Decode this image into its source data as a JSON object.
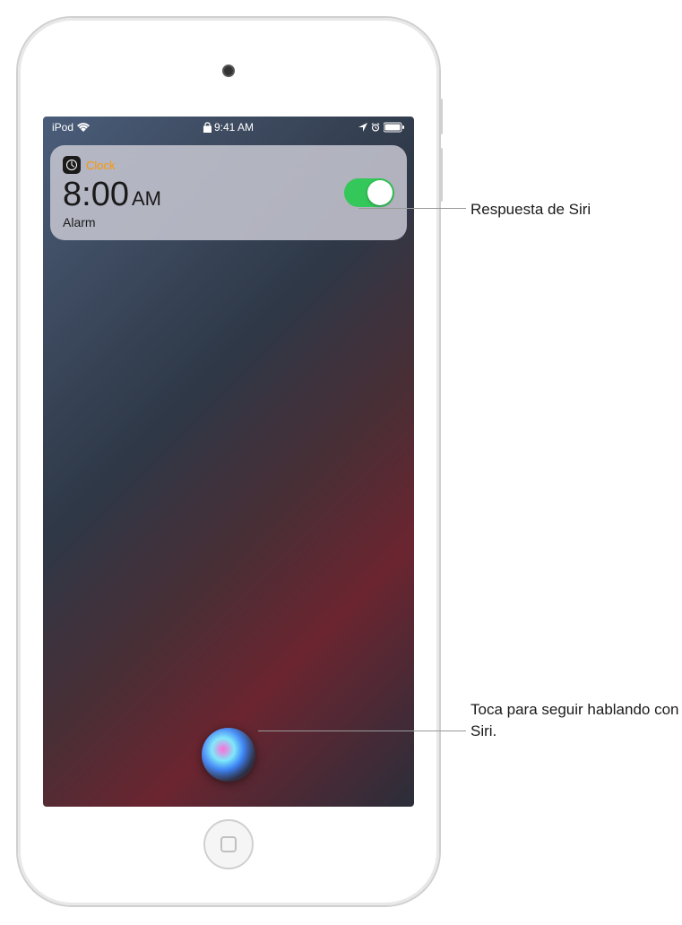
{
  "status_bar": {
    "device": "iPod",
    "time": "9:41 AM"
  },
  "notification": {
    "app_name": "Clock",
    "time": "8:00",
    "ampm": "AM",
    "label": "Alarm",
    "toggle_on": true
  },
  "callouts": {
    "siri_response": "Respuesta de Siri",
    "tap_to_continue": "Toca para seguir hablando con Siri."
  }
}
